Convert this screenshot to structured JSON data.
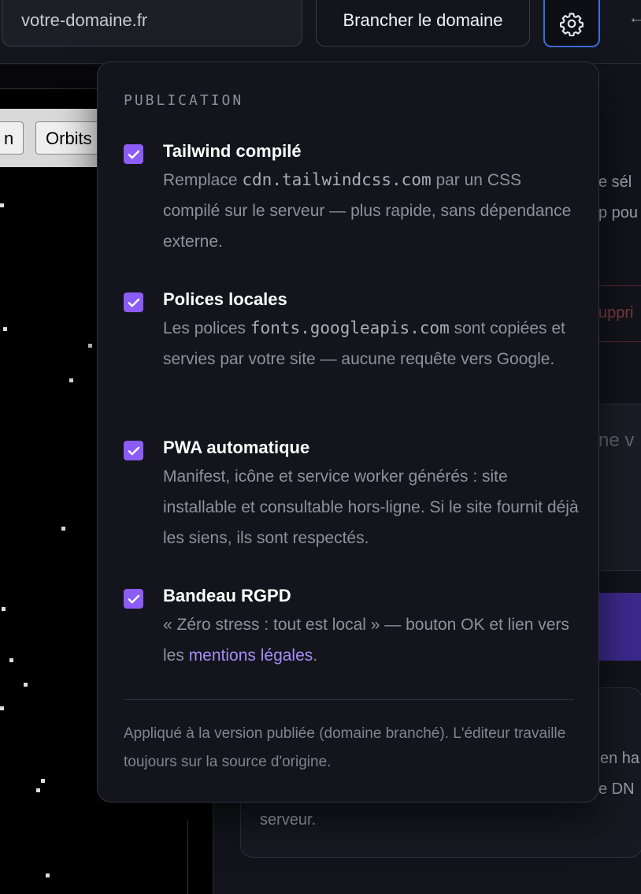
{
  "topbar": {
    "domain_placeholder": "votre-domaine.fr",
    "branch_button": "Brancher le domaine",
    "settings_icon": "gear-icon",
    "back_icon": "arrow-left-icon"
  },
  "preview": {
    "buttons": [
      "n",
      "Orbits"
    ]
  },
  "background": {
    "fragments": [
      "e sél",
      "p pou",
      "uppri",
      "ne v",
      "en ha",
      "e DN",
      "serveur."
    ]
  },
  "publication": {
    "header": "PUBLICATION",
    "options": [
      {
        "title": "Tailwind compilé",
        "checked": true,
        "desc_prefix": "Remplace ",
        "desc_code": "cdn.tailwindcss.com",
        "desc_suffix": " par un CSS compilé sur le serveur — plus rapide, sans dépendance externe."
      },
      {
        "title": "Polices locales",
        "checked": true,
        "desc_prefix": "Les polices ",
        "desc_code": "fonts.googleapis.com",
        "desc_suffix": " sont copiées et servies par votre site — aucune requête vers Google."
      },
      {
        "title": "PWA automatique",
        "checked": true,
        "desc": "Manifest, icône et service worker générés : site installable et consultable hors-ligne. Si le site fournit déjà les siens, ils sont respectés."
      },
      {
        "title": "Bandeau RGPD",
        "checked": true,
        "desc_prefix": "« Zéro stress : tout est local » — bouton OK et lien vers les ",
        "desc_link": "mentions légales",
        "desc_suffix": "."
      }
    ],
    "footer": "Appliqué à la version publiée (domaine branché). L'éditeur travaille toujours sur la source d'origine."
  },
  "colors": {
    "accent": "#8b5cf6",
    "link": "#a78bfa",
    "focus_ring": "#3b6fd8"
  }
}
